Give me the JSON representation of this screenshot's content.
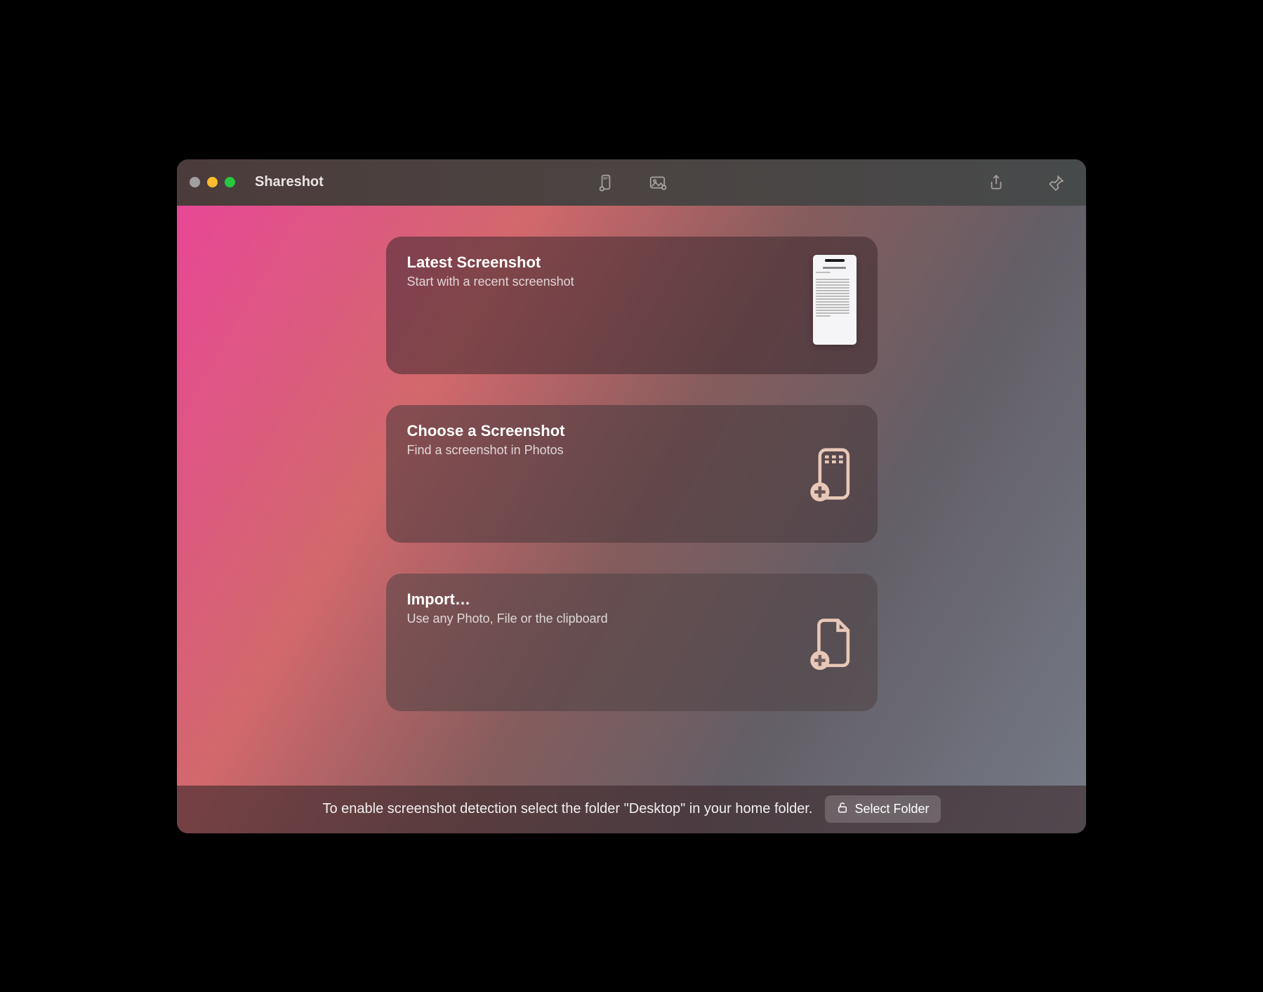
{
  "app_title": "Shareshot",
  "toolbar": {
    "center_icons": [
      "device-add-icon",
      "image-add-icon"
    ],
    "right_icons": [
      "share-icon",
      "pin-icon"
    ]
  },
  "cards": [
    {
      "title": "Latest Screenshot",
      "subtitle": "Start with a recent screenshot",
      "icon": "screenshot-thumbnail"
    },
    {
      "title": "Choose a Screenshot",
      "subtitle": "Find a screenshot in Photos",
      "icon": "device-add-icon"
    },
    {
      "title": "Import…",
      "subtitle": "Use any Photo, File or the clipboard",
      "icon": "file-add-icon"
    }
  ],
  "footer": {
    "message": "To enable screenshot detection select the folder \"Desktop\" in your home folder.",
    "button_label": "Select Folder"
  }
}
